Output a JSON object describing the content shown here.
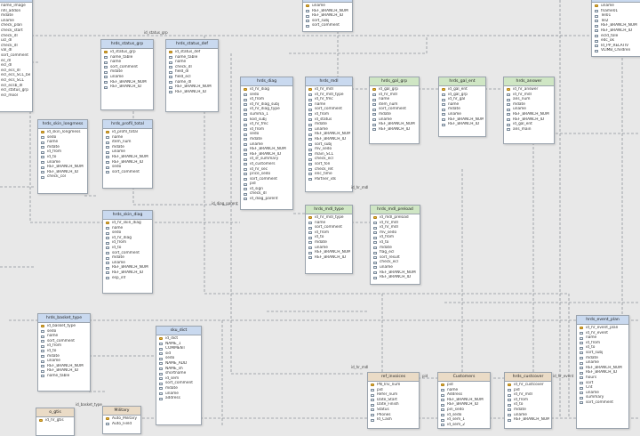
{
  "tables": [
    {
      "id": "t_top_left",
      "title": "",
      "color": "blue",
      "columns": [
        "name_image",
        "nhl_addon",
        "mdate",
        "uname",
        "check_plan",
        "check_start",
        "check_dl",
        "ucl_dl",
        "check_dl",
        "val_dl",
        "sort_comment",
        "ec_dl",
        "ecl_dl",
        "ecl_ecs_dl",
        "ecl_ecs_SCL_bech",
        "ecl_ecs_SCL",
        "ecl_ecsb_dl",
        "ecl_status_grp",
        "ecl_mool"
      ]
    },
    {
      "id": "t_top_mid",
      "title": "",
      "color": "blue",
      "columns": [
        "uname",
        "REF_BRANCH_NUM",
        "REF_BRANCH_ID",
        "sort_subj",
        "sort_comment"
      ]
    },
    {
      "id": "t_top_right",
      "title": "",
      "color": "blue",
      "columns": [
        "uname",
        "fname01",
        "Tel01",
        "Tel2",
        "REF_BRANCH_NUM",
        "REF_BRANCH_ID",
        "ecld_tole",
        "edc_ok",
        "Id_PP_RELATIV",
        "VLIMB_Children"
      ]
    },
    {
      "id": "hrds_status_grp",
      "title": "hrds_status_grp",
      "color": "blue",
      "columns": [
        "id_status_grp",
        "name_table",
        "name",
        "sort_comment",
        "mdate",
        "uname",
        "REF_BRANCH_NUM",
        "REF_BRANCH_ID"
      ]
    },
    {
      "id": "hrds_status_def",
      "title": "hrds_status_def",
      "color": "blue",
      "columns": [
        "id_status_def",
        "name_table",
        "name",
        "check_dl",
        "field_dl",
        "field_ecl",
        "name_dl",
        "REF_BRANCH_NUM",
        "REF_BRANCH_ID"
      ]
    },
    {
      "id": "hrds_diag",
      "title": "hrds_diag",
      "color": "blue",
      "columns": [
        "id_hr_diag",
        "sedo",
        "id_from",
        "id_hr_diag_subj",
        "id_hr_diag_type",
        "summa_1",
        "kod_subj",
        "id_hr_fmc",
        "id_from",
        "sedo",
        "mdate",
        "uname",
        "REF_BRANCH_NUM",
        "REF_BRANCH_ID",
        "id_sf_summary",
        "id_customers",
        "id_hr_sec",
        "price_sedo",
        "sort_comment",
        "pid",
        "id_sign",
        "check_dl",
        "id_diag_parent"
      ]
    },
    {
      "id": "hrds_mdl",
      "title": "hrds_mdl",
      "color": "blue",
      "columns": [
        "id_hr_mdl",
        "id_hr_mdl_type",
        "id_hr_fmc",
        "name",
        "sort_comment",
        "id_from",
        "id_status",
        "mdate",
        "uname",
        "REF_BRANCH_NUM",
        "REF_BRANCH_ID",
        "sort_subj",
        "mv_sedo",
        "main_SCL",
        "check_ecl",
        "sort_fon",
        "check_ret",
        "enc_time",
        "Partner_ids"
      ]
    },
    {
      "id": "hrds_gal_grp",
      "title": "hrds_gal_grp",
      "color": "green",
      "columns": [
        "id_gal_grp",
        "id_hr_mdl",
        "name",
        "item_num",
        "sort_comment",
        "mdate",
        "uname",
        "REF_BRANCH_NUM",
        "REF_BRANCH_ID"
      ]
    },
    {
      "id": "hrds_gal_ent",
      "title": "hrds_gal_ent",
      "color": "green",
      "columns": [
        "id_gal_ent",
        "id_gal_grp",
        "id_hr_gal",
        "name",
        "mdate",
        "uname",
        "REF_BRANCH_NUM",
        "REF_BRANCH_ID"
      ]
    },
    {
      "id": "hrds_answer",
      "title": "hrds_answer",
      "color": "green",
      "columns": [
        "id_hr_answer",
        "id_hr_mdl",
        "ans_num",
        "mdate",
        "uname",
        "REF_BRANCH_NUM",
        "REF_BRANCH_ID",
        "id_gal_ent",
        "ans_main"
      ]
    },
    {
      "id": "hrds_skin_longmess",
      "title": "hrds_skin_longmess",
      "color": "blue",
      "columns": [
        "id_skin_longmess",
        "sedo",
        "name",
        "mdate",
        "id_from",
        "id_to",
        "uname",
        "REF_BRANCH_NUM",
        "REF_BRANCH_ID",
        "check_col"
      ]
    },
    {
      "id": "hrds_profil_total",
      "title": "hrds_profil_total",
      "color": "blue",
      "columns": [
        "id_profil_total",
        "name",
        "item_num",
        "mdate",
        "uname",
        "REF_BRANCH_NUM",
        "REF_BRANCH_ID",
        "sedo",
        "sort_comment"
      ]
    },
    {
      "id": "hrds_skin_diag",
      "title": "hrds_skin_diag",
      "color": "blue",
      "columns": [
        "id_hr_skin_diag",
        "name",
        "sedo",
        "id_hr_diag",
        "id_from",
        "id_to",
        "sort_comment",
        "mdate",
        "uname",
        "REF_BRANCH_NUM",
        "REF_BRANCH_ID",
        "esp_inf"
      ]
    },
    {
      "id": "hrds_mdl_type",
      "title": "hrds_mdl_type",
      "color": "green",
      "columns": [
        "id_hr_mdl_type",
        "name",
        "sort_comment",
        "id_from",
        "id_to",
        "mdate",
        "uname",
        "REF_BRANCH_NUM",
        "REF_BRANCH_ID"
      ]
    },
    {
      "id": "hrds_mdl_preload",
      "title": "hrds_mdl_preload",
      "color": "green",
      "columns": [
        "id_mdl_preload",
        "id_hr_mdl",
        "id_hr_mdl",
        "mv_sedo",
        "id_from",
        "id_to",
        "mdate",
        "flag_ecl",
        "sort_result",
        "check_ecl",
        "uname",
        "REF_BRANCH_NUM",
        "REF_BRANCH_ID"
      ]
    },
    {
      "id": "hrds_basket_type",
      "title": "hrds_basket_type",
      "color": "blue",
      "columns": [
        "id_basket_type",
        "sedo",
        "name",
        "sort_comment",
        "id_from",
        "id_to",
        "mdate",
        "uname",
        "REF_BRANCH_NUM",
        "REF_BRANCH_ID",
        "name_table"
      ]
    },
    {
      "id": "sku_dict",
      "title": "sku_dict",
      "color": "blue",
      "columns": [
        "id_dict",
        "NAME_1",
        "COMMENT",
        "sid",
        "sedo",
        "NAME_ADD",
        "NAME_sh",
        "shortname",
        "id_sem",
        "sort_comment",
        "mdate",
        "uname",
        "address"
      ]
    },
    {
      "id": "hrds_event_plan",
      "title": "hrds_event_plan",
      "color": "blue",
      "columns": [
        "id_hr_event_plan",
        "id_hr_event",
        "name",
        "id_from",
        "id_to",
        "sort_subj",
        "mdate",
        "uname",
        "REF_BRANCH_NUM",
        "REF_BRANCH_ID",
        "hours",
        "sort",
        "Cnt",
        "uname",
        "summary",
        "sort_comment"
      ]
    },
    {
      "id": "ref_invoices",
      "title": "ref_invoices",
      "color": "tan",
      "columns": [
        "PN_Inv_num",
        "pid",
        "Refer_num",
        "Date_Start",
        "Date_Finish",
        "Status",
        "Phones",
        "Id_Cash"
      ]
    },
    {
      "id": "customers",
      "title": "Customers",
      "color": "tan",
      "columns": [
        "pid",
        "name",
        "Address",
        "REF_BRANCH_NUM",
        "REF_BRANCH_ID",
        "pin_sedo",
        "id_sedo",
        "id_sem_1",
        "id_sem_2"
      ]
    },
    {
      "id": "hrds_custcover",
      "title": "hrds_custcover",
      "color": "tan",
      "columns": [
        "id_hr_custcover",
        "pid",
        "id_hr_mdl",
        "id_from",
        "id_to",
        "mdate",
        "uname",
        "REF_BRANCH_NUM"
      ]
    },
    {
      "id": "military",
      "title": "Military",
      "color": "tan",
      "columns": [
        "Auto_Military",
        "Auto_Field"
      ]
    },
    {
      "id": "b_gtis",
      "title": "o_gtis",
      "color": "tan",
      "columns": [
        "id_hr_gtis"
      ]
    }
  ],
  "labels": [
    {
      "id": "lbl1",
      "text": "id_status_grp"
    },
    {
      "id": "lbl2",
      "text": "id_diag_parent"
    },
    {
      "id": "lbl3",
      "text": "id_hr_mdl"
    },
    {
      "id": "lbl4",
      "text": "id_basket_type"
    },
    {
      "id": "lbl5",
      "text": "pid"
    },
    {
      "id": "lbl6",
      "text": "id_hr_mdl"
    },
    {
      "id": "lbl7",
      "text": "id_hr_event"
    }
  ]
}
